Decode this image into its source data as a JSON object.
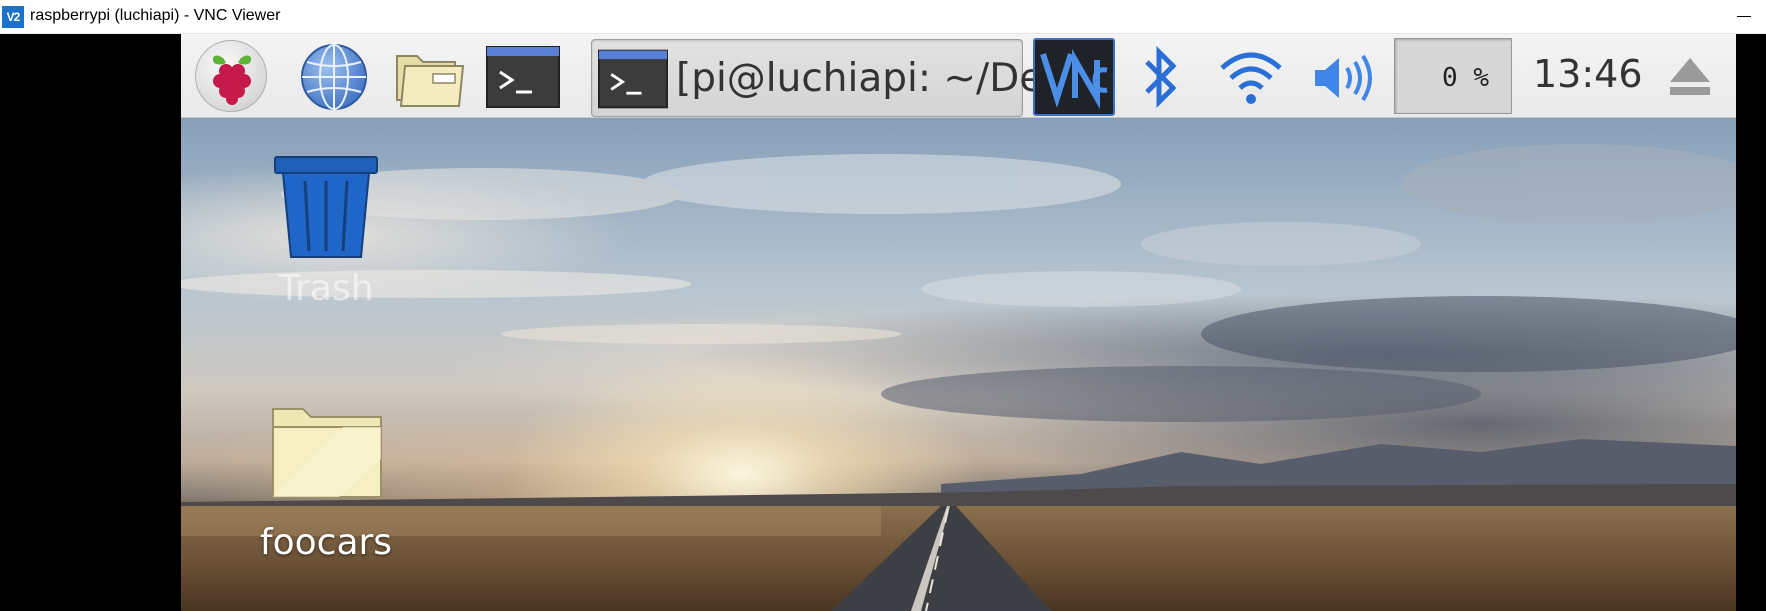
{
  "window": {
    "title": "raspberrypi (luchiapi) - VNC Viewer",
    "app_icon_text": "V2"
  },
  "taskbar": {
    "menu_icon": "raspberry-pi-icon",
    "launchers": [
      {
        "name": "web-browser",
        "icon": "globe-icon"
      },
      {
        "name": "file-manager",
        "icon": "folder-icon"
      },
      {
        "name": "terminal",
        "icon": "terminal-icon"
      }
    ],
    "active_window": {
      "label": "[pi@luchiapi: ~/De...",
      "icon": "terminal-icon"
    },
    "tray": {
      "vnc_icon": "vnc-icon",
      "bluetooth_icon": "bluetooth-icon",
      "wifi_icon": "wifi-icon",
      "volume_icon": "volume-icon",
      "cpu_usage": "0 %",
      "clock": "13:46",
      "eject_icon": "eject-icon"
    },
    "colors": {
      "accent_blue": "#3a72c4",
      "terminal_dark": "#3c3c3c"
    }
  },
  "desktop": {
    "icons": [
      {
        "label": "Trash",
        "icon": "trash-icon"
      },
      {
        "label": "foocars",
        "icon": "folder-icon"
      }
    ]
  }
}
